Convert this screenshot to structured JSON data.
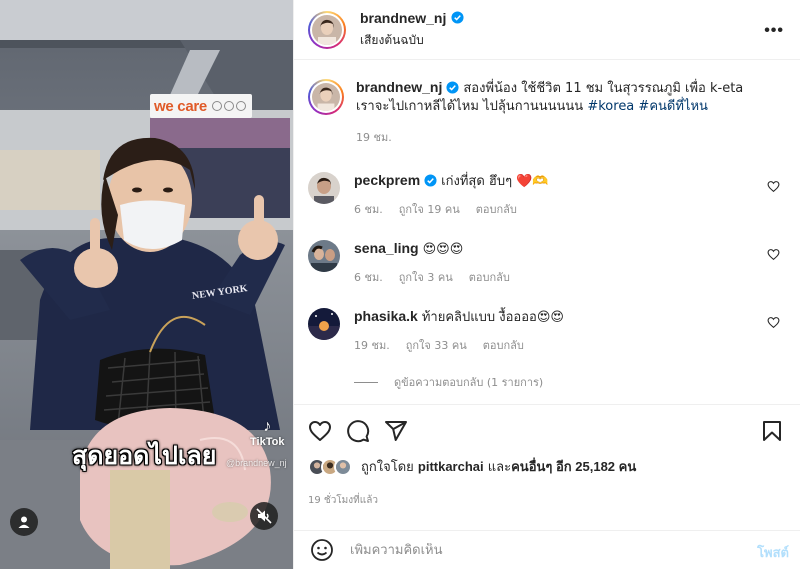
{
  "post": {
    "username": "brandnew_nj",
    "audio": "เสียงต้นฉบับ",
    "more": "•••",
    "verified_icon": "verified-badge-icon",
    "accent": "#0095f6"
  },
  "media": {
    "signage": "we care",
    "jacket_text": "NEW YORK",
    "caption": "สุดยอดไปเลย",
    "tiktok_label": "TikTok",
    "tiktok_user": "@brandnew_nj",
    "watermark_brand": "TikTok"
  },
  "caption": {
    "username": "brandnew_nj",
    "text": "สองพี่น้อง ใช้ชีวิต 11 ชม ในสุวรรณภูมิ เพื่อ k-eta เราจะไปเกาหลีได้ไหม ไปลุ้นกานนนนนน",
    "hashtag1": "#korea",
    "hashtag2": "#คนดีที่ไหน",
    "time": "19 ชม."
  },
  "comments": [
    {
      "username": "peckprem",
      "verified": true,
      "text": "เก่งที่สุด ฮึบๆ ❤️🫶",
      "time": "6 ชม.",
      "likes": "ถูกใจ 19 คน",
      "reply": "ตอบกลับ"
    },
    {
      "username": "sena_ling",
      "verified": false,
      "text": "😍😍😍",
      "time": "6 ชม.",
      "likes": "ถูกใจ 3 คน",
      "reply": "ตอบกลับ"
    },
    {
      "username": "phasika.k",
      "verified": false,
      "text": "ท้ายคลิปแบบ งื้ออออ😍😍",
      "time": "19 ชม.",
      "likes": "ถูกใจ 33 คน",
      "reply": "ตอบกลับ"
    }
  ],
  "view_replies": "ดูข้อความตอบกลับ (1 รายการ)",
  "likes": {
    "prefix": "ถูกใจโดย",
    "user": "pittkarchai",
    "middle": "และ",
    "others": "คนอื่นๆ อีก 25,182 คน"
  },
  "posted_ago": "19 ชั่วโมงที่แล้ว",
  "comment_box": {
    "placeholder": "เพิ่มความคิดเห็น",
    "post_label": "โพสต์"
  }
}
